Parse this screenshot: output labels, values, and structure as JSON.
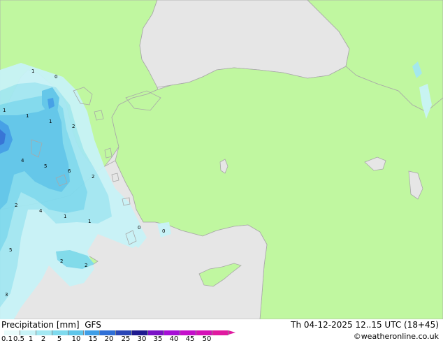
{
  "header": {
    "title": "Precipitation [mm]",
    "model": "GFS",
    "valid_time": "Th 04-12-2025 12..15 UTC (18+45)",
    "credit": "©weatheronline.co.uk"
  },
  "legend": {
    "ticks": [
      "0.1",
      "0.5",
      "1",
      "2",
      "5",
      "10",
      "15",
      "20",
      "25",
      "30",
      "35",
      "40",
      "45",
      "50"
    ],
    "colors": [
      "#e8fbfb",
      "#c8f3f7",
      "#a3e8f2",
      "#7fdaee",
      "#5fc6ea",
      "#3f9ee6",
      "#2f6fd6",
      "#2a46b6",
      "#1e1a8f",
      "#7a12c6",
      "#a60fd6",
      "#c40fcb",
      "#d411b7",
      "#e01aa0"
    ]
  },
  "colors": {
    "land": "#c0f7a0",
    "sea_land_outside": "#e6e6e6",
    "coast": "#a8a8a8"
  },
  "map_labels": [
    {
      "text": "1"
    },
    {
      "text": "0"
    },
    {
      "text": "1"
    },
    {
      "text": "1"
    },
    {
      "text": "1"
    },
    {
      "text": "2"
    },
    {
      "text": "4"
    },
    {
      "text": "5"
    },
    {
      "text": "6"
    },
    {
      "text": "2"
    },
    {
      "text": "2"
    },
    {
      "text": "4"
    },
    {
      "text": "1"
    },
    {
      "text": "1"
    },
    {
      "text": "0"
    },
    {
      "text": "0"
    },
    {
      "text": "5"
    },
    {
      "text": "2"
    },
    {
      "text": "2"
    },
    {
      "text": "3"
    }
  ]
}
